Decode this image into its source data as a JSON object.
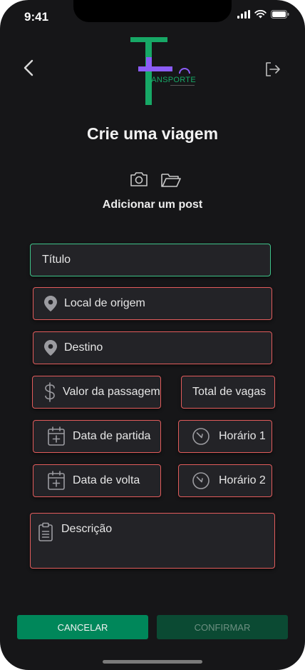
{
  "status_bar": {
    "time": "9:41"
  },
  "logo": {
    "brand_text": "RANSPORTE"
  },
  "page": {
    "title": "Crie uma viagem",
    "post_label": "Adicionar um post"
  },
  "form": {
    "titulo_placeholder": "Título",
    "origem_placeholder": "Local de origem",
    "destino_placeholder": "Destino",
    "valor_placeholder": "Valor da passagem",
    "vagas_placeholder": "Total de vagas",
    "partida_placeholder": "Data de partida",
    "horario1_placeholder": "Horário 1",
    "volta_placeholder": "Data de volta",
    "horario2_placeholder": "Horário 2",
    "descricao_placeholder": "Descrição"
  },
  "actions": {
    "cancel_label": "CANCELAR",
    "confirm_label": "CONFIRMAR"
  },
  "colors": {
    "background": "#161618",
    "field_border": "#e25c5c",
    "focus_border": "#3fc48a",
    "brand_green": "#17a866",
    "brand_purple": "#8b5cf6",
    "cancel_button": "#00875a",
    "confirm_button": "#0b4a33"
  }
}
